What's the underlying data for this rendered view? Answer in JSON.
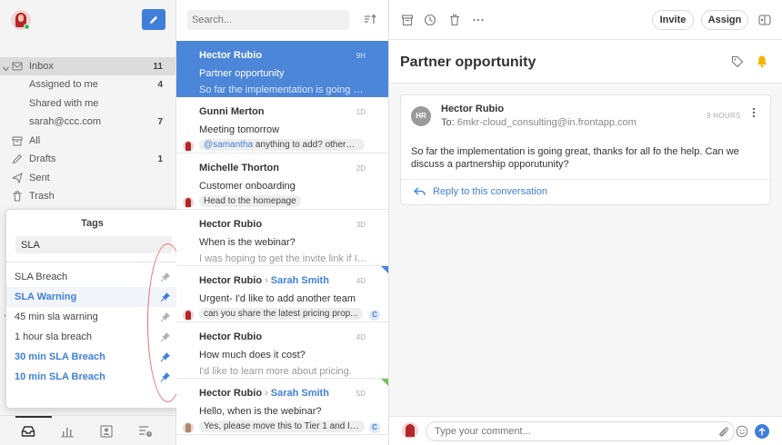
{
  "sidebar": {
    "nav": [
      {
        "label": "Inbox",
        "count": "11",
        "icon": "inbox-icon"
      },
      {
        "label": "Assigned to me",
        "count": "4"
      },
      {
        "label": "Shared with me",
        "count": ""
      },
      {
        "label": "sarah@ccc.com",
        "count": "7"
      },
      {
        "label": "All",
        "count": "",
        "icon": "archive-icon"
      },
      {
        "label": "Drafts",
        "count": "1",
        "icon": "drafts-icon"
      },
      {
        "label": "Sent",
        "count": "",
        "icon": "send-icon"
      },
      {
        "label": "Trash",
        "count": "",
        "icon": "trash-icon"
      }
    ],
    "bottom_icons": [
      "inbox-tray-icon",
      "analytics-icon",
      "contacts-icon",
      "rules-icon"
    ]
  },
  "tags_popup": {
    "title": "Tags",
    "search_value": "SLA",
    "tags": [
      {
        "name": "SLA Breach",
        "pinned": false
      },
      {
        "name": "SLA Warning",
        "pinned": true
      },
      {
        "name": "45 min sla warning",
        "pinned": false
      },
      {
        "name": "1 hour sla breach",
        "pinned": false
      },
      {
        "name": "30 min SLA Breach",
        "pinned": true
      },
      {
        "name": "10 min SLA Breach",
        "pinned": true
      }
    ]
  },
  "list": {
    "search_placeholder": "Search...",
    "messages": [
      {
        "sender": "Hector Rubio",
        "to": "",
        "time": "9H",
        "subject": "Partner opportunity",
        "preview": "So far the implementation is going gr..."
      },
      {
        "sender": "Gunni Merton",
        "to": "",
        "time": "1D",
        "subject": "Meeting tomorrow",
        "mention": "@samantha",
        "preview": " anything to add? otherwi..."
      },
      {
        "sender": "Michelle Thorton",
        "to": "",
        "time": "2D",
        "subject": "Customer onboarding",
        "preview": "Head to the homepage"
      },
      {
        "sender": "Hector Rubio",
        "to": "",
        "time": "3D",
        "subject": "When is the webinar?",
        "preview": "I was hoping to get the invite link if I ..."
      },
      {
        "sender": "Hector Rubio",
        "to": "Sarah Smith",
        "time": "4D",
        "subject": "Urgent- I'd like to add another team",
        "preview": "can you share the latest pricing prop...",
        "badge": "C"
      },
      {
        "sender": "Hector Rubio",
        "to": "",
        "time": "4D",
        "subject": "How much does it cost?",
        "preview": "I'd like to learn more about pricing."
      },
      {
        "sender": "Hector Rubio",
        "to": "Sarah Smith",
        "time": "5D",
        "subject": "Hello, when is the webinar?",
        "preview": "Yes, please move this to Tier 1 and I'll...",
        "badge": "C"
      }
    ]
  },
  "conversation": {
    "invite_label": "Invite",
    "assign_label": "Assign",
    "title": "Partner opportunity",
    "email": {
      "initials": "HR",
      "from": "Hector Rubio",
      "to_label": "To:",
      "to_address": "6mkr-cloud_consulting@in.frontapp.com",
      "ago": "9 HOURS",
      "body": "So far the implementation is going great, thanks for all fo the help. Can we discuss a partnership opporutunity?",
      "reply_label": "Reply to this conversation"
    },
    "comment_placeholder": "Type your comment..."
  },
  "colors": {
    "accent": "#3f7fd9",
    "selected_row": "#4c86d8",
    "bell": "#f2b600",
    "annotation": "#e0746c"
  }
}
